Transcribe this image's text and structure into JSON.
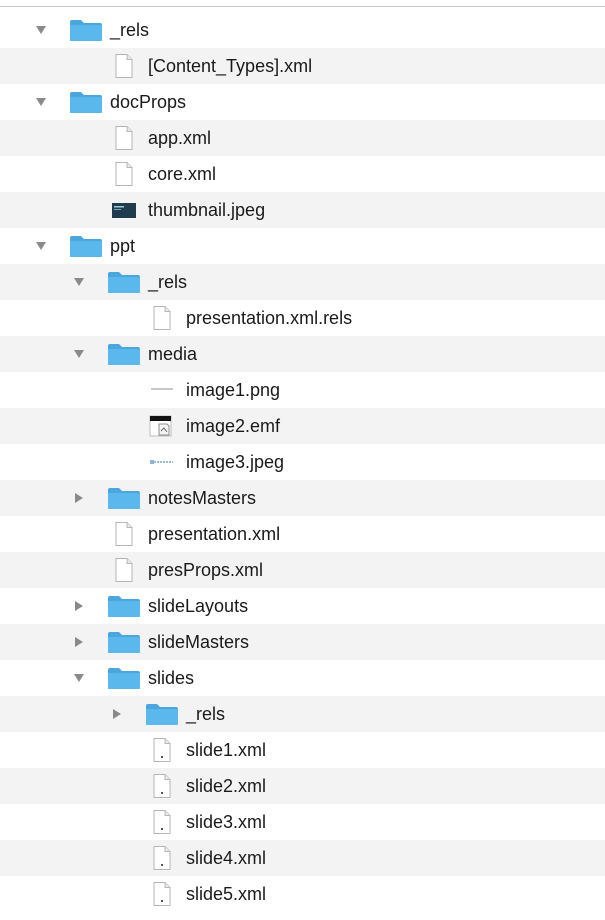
{
  "tree": {
    "rows": [
      {
        "label": "_rels",
        "type": "folder",
        "expanded": true
      },
      {
        "label": "[Content_Types].xml",
        "type": "file"
      },
      {
        "label": "docProps",
        "type": "folder",
        "expanded": true
      },
      {
        "label": "app.xml",
        "type": "file"
      },
      {
        "label": "core.xml",
        "type": "file"
      },
      {
        "label": "thumbnail.jpeg",
        "type": "image-thumbnail"
      },
      {
        "label": "ppt",
        "type": "folder",
        "expanded": true
      },
      {
        "label": "_rels",
        "type": "folder",
        "expanded": true
      },
      {
        "label": "presentation.xml.rels",
        "type": "file"
      },
      {
        "label": "media",
        "type": "folder",
        "expanded": true
      },
      {
        "label": "image1.png",
        "type": "image-line"
      },
      {
        "label": "image2.emf",
        "type": "emf"
      },
      {
        "label": "image3.jpeg",
        "type": "image-line"
      },
      {
        "label": "notesMasters",
        "type": "folder",
        "expanded": false
      },
      {
        "label": "presentation.xml",
        "type": "file"
      },
      {
        "label": "presProps.xml",
        "type": "file"
      },
      {
        "label": "slideLayouts",
        "type": "folder",
        "expanded": false
      },
      {
        "label": "slideMasters",
        "type": "folder",
        "expanded": false
      },
      {
        "label": "slides",
        "type": "folder",
        "expanded": true
      },
      {
        "label": "_rels",
        "type": "folder",
        "expanded": false
      },
      {
        "label": "slide1.xml",
        "type": "xml-file"
      },
      {
        "label": "slide2.xml",
        "type": "xml-file"
      },
      {
        "label": "slide3.xml",
        "type": "xml-file"
      },
      {
        "label": "slide4.xml",
        "type": "xml-file"
      },
      {
        "label": "slide5.xml",
        "type": "xml-file"
      }
    ]
  },
  "colors": {
    "folder": "#5bb8ec",
    "folder_tab": "#4aa6dc",
    "disclosure": "#8a8a8a",
    "stripe": "#f3f3f3",
    "text": "#1a1a1a"
  }
}
